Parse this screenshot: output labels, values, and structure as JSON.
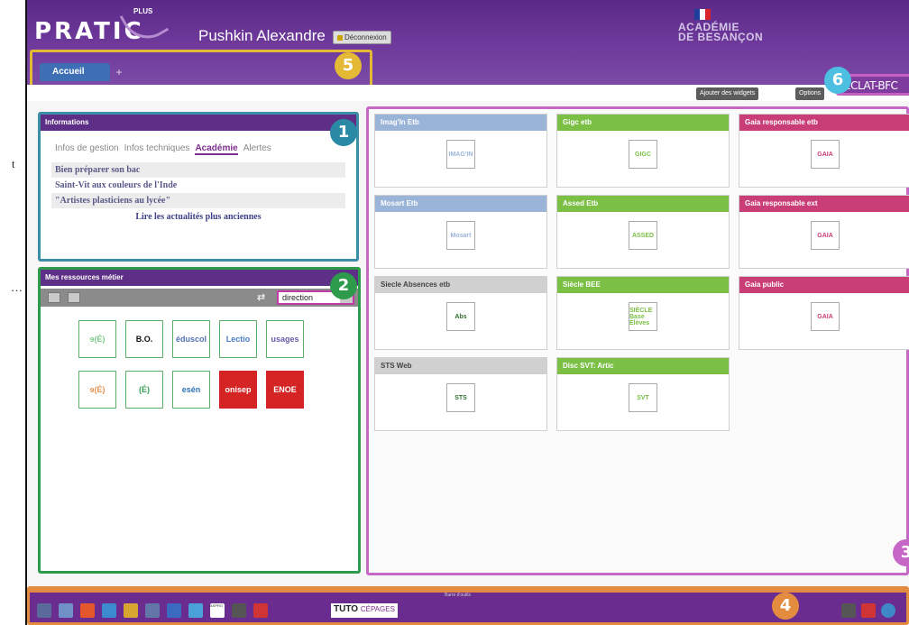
{
  "left_fragment": {
    "chars": [
      "t",
      "…"
    ]
  },
  "header": {
    "logo_text": "PRATIC",
    "logo_plus": "PLUS",
    "user_name": "Pushkin Alexandre",
    "logout_label": "Déconnexion",
    "academy_line1": "ACADÉMIE",
    "academy_line2": "DE BESANÇON",
    "flag_colors": [
      "#1f3f9e",
      "#ffffff",
      "#d8232a"
    ]
  },
  "tabs": {
    "home_label": "Accueil",
    "add_label": "+"
  },
  "toolbar": {
    "add_widgets_label": "Ajouter des widgets",
    "options_label": "Options",
    "eclat_label": "ÉCLAT-BFC"
  },
  "markers": {
    "m1": "1",
    "m2": "2",
    "m3": "3",
    "m4": "4",
    "m5": "5",
    "m6": "6"
  },
  "marker_colors": {
    "m1": "#2a8aa5",
    "m2": "#2e9a4b",
    "m3": "#c667c7",
    "m4": "#e38b3f",
    "m5": "#e4b935",
    "m6": "#4dbfe0"
  },
  "info_widget": {
    "title": "Informations",
    "subtabs": [
      "Infos de gestion",
      "Infos techniques",
      "Académie",
      "Alertes"
    ],
    "active_subtab": "Académie",
    "news": [
      "Bien préparer son bac",
      "Saint-Vit aux couleurs de l'Inde",
      "\"Artistes plasticiens au lycée\""
    ],
    "more_link": "Lire les actualités plus anciennes"
  },
  "resources_widget": {
    "title": "Mes ressources métier",
    "select_value": "direction",
    "swap_icon": "⇄",
    "tiles": [
      {
        "name": "tile-eduscol",
        "label": "ɘ(É)",
        "color": "#7cc98a"
      },
      {
        "name": "tile-bo",
        "label": "B.O.",
        "color": "#111111"
      },
      {
        "name": "tile-eduscol-2",
        "label": "éduscol",
        "color": "#5470b8"
      },
      {
        "name": "tile-lectio",
        "label": "Lectio",
        "color": "#4a7cc8"
      },
      {
        "name": "tile-usages",
        "label": "usages",
        "color": "#6a5aa8"
      },
      {
        "name": "tile-eduscol-3",
        "label": "ɘ(É)",
        "color": "#e59050"
      },
      {
        "name": "tile-eduscol-4",
        "label": "(É)",
        "color": "#3aa05a"
      },
      {
        "name": "tile-esen",
        "label": "esén",
        "color": "#2f70b8"
      },
      {
        "name": "tile-onisep",
        "label": "onisep",
        "color": "#d42424"
      },
      {
        "name": "tile-enoe",
        "label": "ENOE",
        "color": "#d42424"
      }
    ]
  },
  "cards": [
    {
      "title": "Imag'In Etb",
      "icon_text": "IMAG'IN",
      "color": "#9ab4d8"
    },
    {
      "title": "Mosart Etb",
      "icon_text": "Mosart",
      "color": "#9ab4d8"
    },
    {
      "title": "Siecle Absences etb",
      "icon_text": "Abs",
      "color": "#d0d0d0"
    },
    {
      "title": "STS Web",
      "icon_text": "STS",
      "color": "#d0d0d0"
    },
    {
      "title": "Gigc etb",
      "icon_text": "GIGC",
      "color": "#7bbf45"
    },
    {
      "title": "Assed Etb",
      "icon_text": "ASSED",
      "color": "#7bbf45"
    },
    {
      "title": "Siècle BEE",
      "icon_text": "SIÈCLE Base Élèves",
      "color": "#7bbf45"
    },
    {
      "title": "Disc SVT: Artic",
      "icon_text": "SVT",
      "color": "#7bbf45"
    },
    {
      "title": "Gaia responsable etb",
      "icon_text": "GAIA",
      "color": "#c93e77"
    },
    {
      "title": "Gaia responsable ext",
      "icon_text": "GAIA",
      "color": "#c93e77"
    },
    {
      "title": "Gaia public",
      "icon_text": "GAIA",
      "color": "#c93e77"
    }
  ],
  "dock": {
    "title": "Barre d'outils",
    "tuto_label": "TUTO",
    "cepages_label": "CÉPAGES",
    "aspro_label": "ASPRO",
    "icon_colors": [
      "#5a6a9a",
      "#7090c8",
      "#e4562b",
      "#3c8bd0",
      "#d9a531",
      "#6277a8",
      "#3a6bc0",
      "#4aa0d8",
      "#d03aa8",
      "#555555",
      "#d03434",
      "#3e88c8"
    ]
  }
}
